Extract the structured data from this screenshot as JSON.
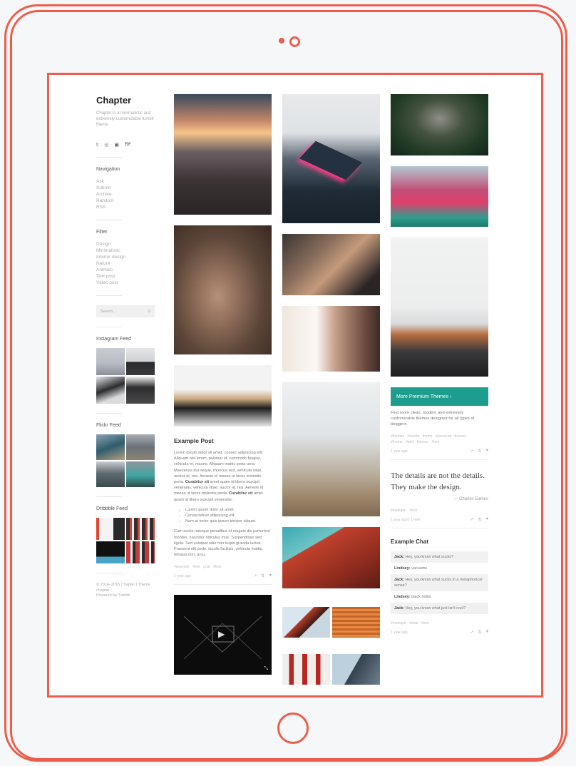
{
  "blog": {
    "title": "Chapter",
    "description": "Chapter is a minimalistic and extremely customizable tumblr theme"
  },
  "social_icons": [
    "twitter-icon",
    "dribbble-icon",
    "instagram-icon",
    "behance-icon"
  ],
  "social_glyphs": [
    "𝕥",
    "◎",
    "▣",
    "Bē"
  ],
  "navigation": {
    "title": "Navigation",
    "items": [
      "Ask",
      "Submit",
      "Archive",
      "Random",
      "RSS"
    ]
  },
  "filter": {
    "title": "Filter",
    "items": [
      "Design",
      "Minimalistic",
      "Interior design",
      "Nature",
      "Animals",
      "Text post",
      "Video post"
    ]
  },
  "search": {
    "placeholder": "Search..."
  },
  "feeds": {
    "instagram": "Instagram Feed",
    "flickr": "Flickr Feed",
    "dribbble": "Dribbble Feed"
  },
  "footer": {
    "line1": "© 2014–2016 Chapter | Theme",
    "line2": "chapter",
    "line3": "Powered by Tumblr"
  },
  "example_post": {
    "title": "Example Post",
    "para1_a": "Lorem ipsum dolor sit amet, consec adipiscing elit. Aliquam nisl lorem, pulvinar id, commodo feugiat, vehicula et, mauris. Aliquam mattis porta urna. Maecenas dui neque, rhoncus sed, vehicula vitae, auctor at, nisi. Aenean id massa ut lacus molestie porta.",
    "bold1": "Curabitur sit",
    "para1_b": "amet quam id libero suscipit venenatis, vehicula vitae, auctor at, nisi. Aenean id massa ut lacus molestie porta.",
    "bold2": "Curabitur sit",
    "para1_c": "amet quam id libero suscipit venenatis.",
    "bullets": [
      "Lorem ipsum dolor sit amet.",
      "Consectetuer adipiscing elit.",
      "Nam at tortor quis ipsum tempor aliquet."
    ],
    "para2": "Cum sociis natoque penatibus et magnis dis parturient montes, nascetur ridiculus mus. Suspendisse sed ligula. Sed volutpat odio non turpis gravida luctus. Praesent elit pede, iaculis facilisis, vehicula mattis, tempus non, arcu.",
    "tags": "#example  #text post  #text",
    "time": "1 year ago"
  },
  "premium": {
    "button": "More Premium Themes  ›",
    "text": "Find more clean, modern and extremely customizable themes designed for all types of bloggers.",
    "tags_line1": "#themes  #tumblr theme  #premium themes",
    "tags_line2": "#theme  #grid themes  #text",
    "time": "1 year ago"
  },
  "quote": {
    "text": "The details are not the details. They make the design.",
    "author": "—  Charles Eames",
    "tags": "#example  #text",
    "meta": "1 year ago | 1 note"
  },
  "chat": {
    "title": "Example Chat",
    "lines": [
      {
        "speaker": "Jack:",
        "text": " Hey, you know what sucks?"
      },
      {
        "speaker": "Lindsey:",
        "text": " vacuums"
      },
      {
        "speaker": "Jack:",
        "text": " Hey, you know what sucks in a metaphorical sense?"
      },
      {
        "speaker": "Lindsey:",
        "text": " black holes"
      },
      {
        "speaker": "Jack:",
        "text": " Hey, you know what just isn't cool?"
      }
    ],
    "tags": "#example  #chat  #text",
    "time": "1 year ago"
  },
  "colors": {
    "frame": "#ec5d4b",
    "accent": "#1d9d8e"
  }
}
